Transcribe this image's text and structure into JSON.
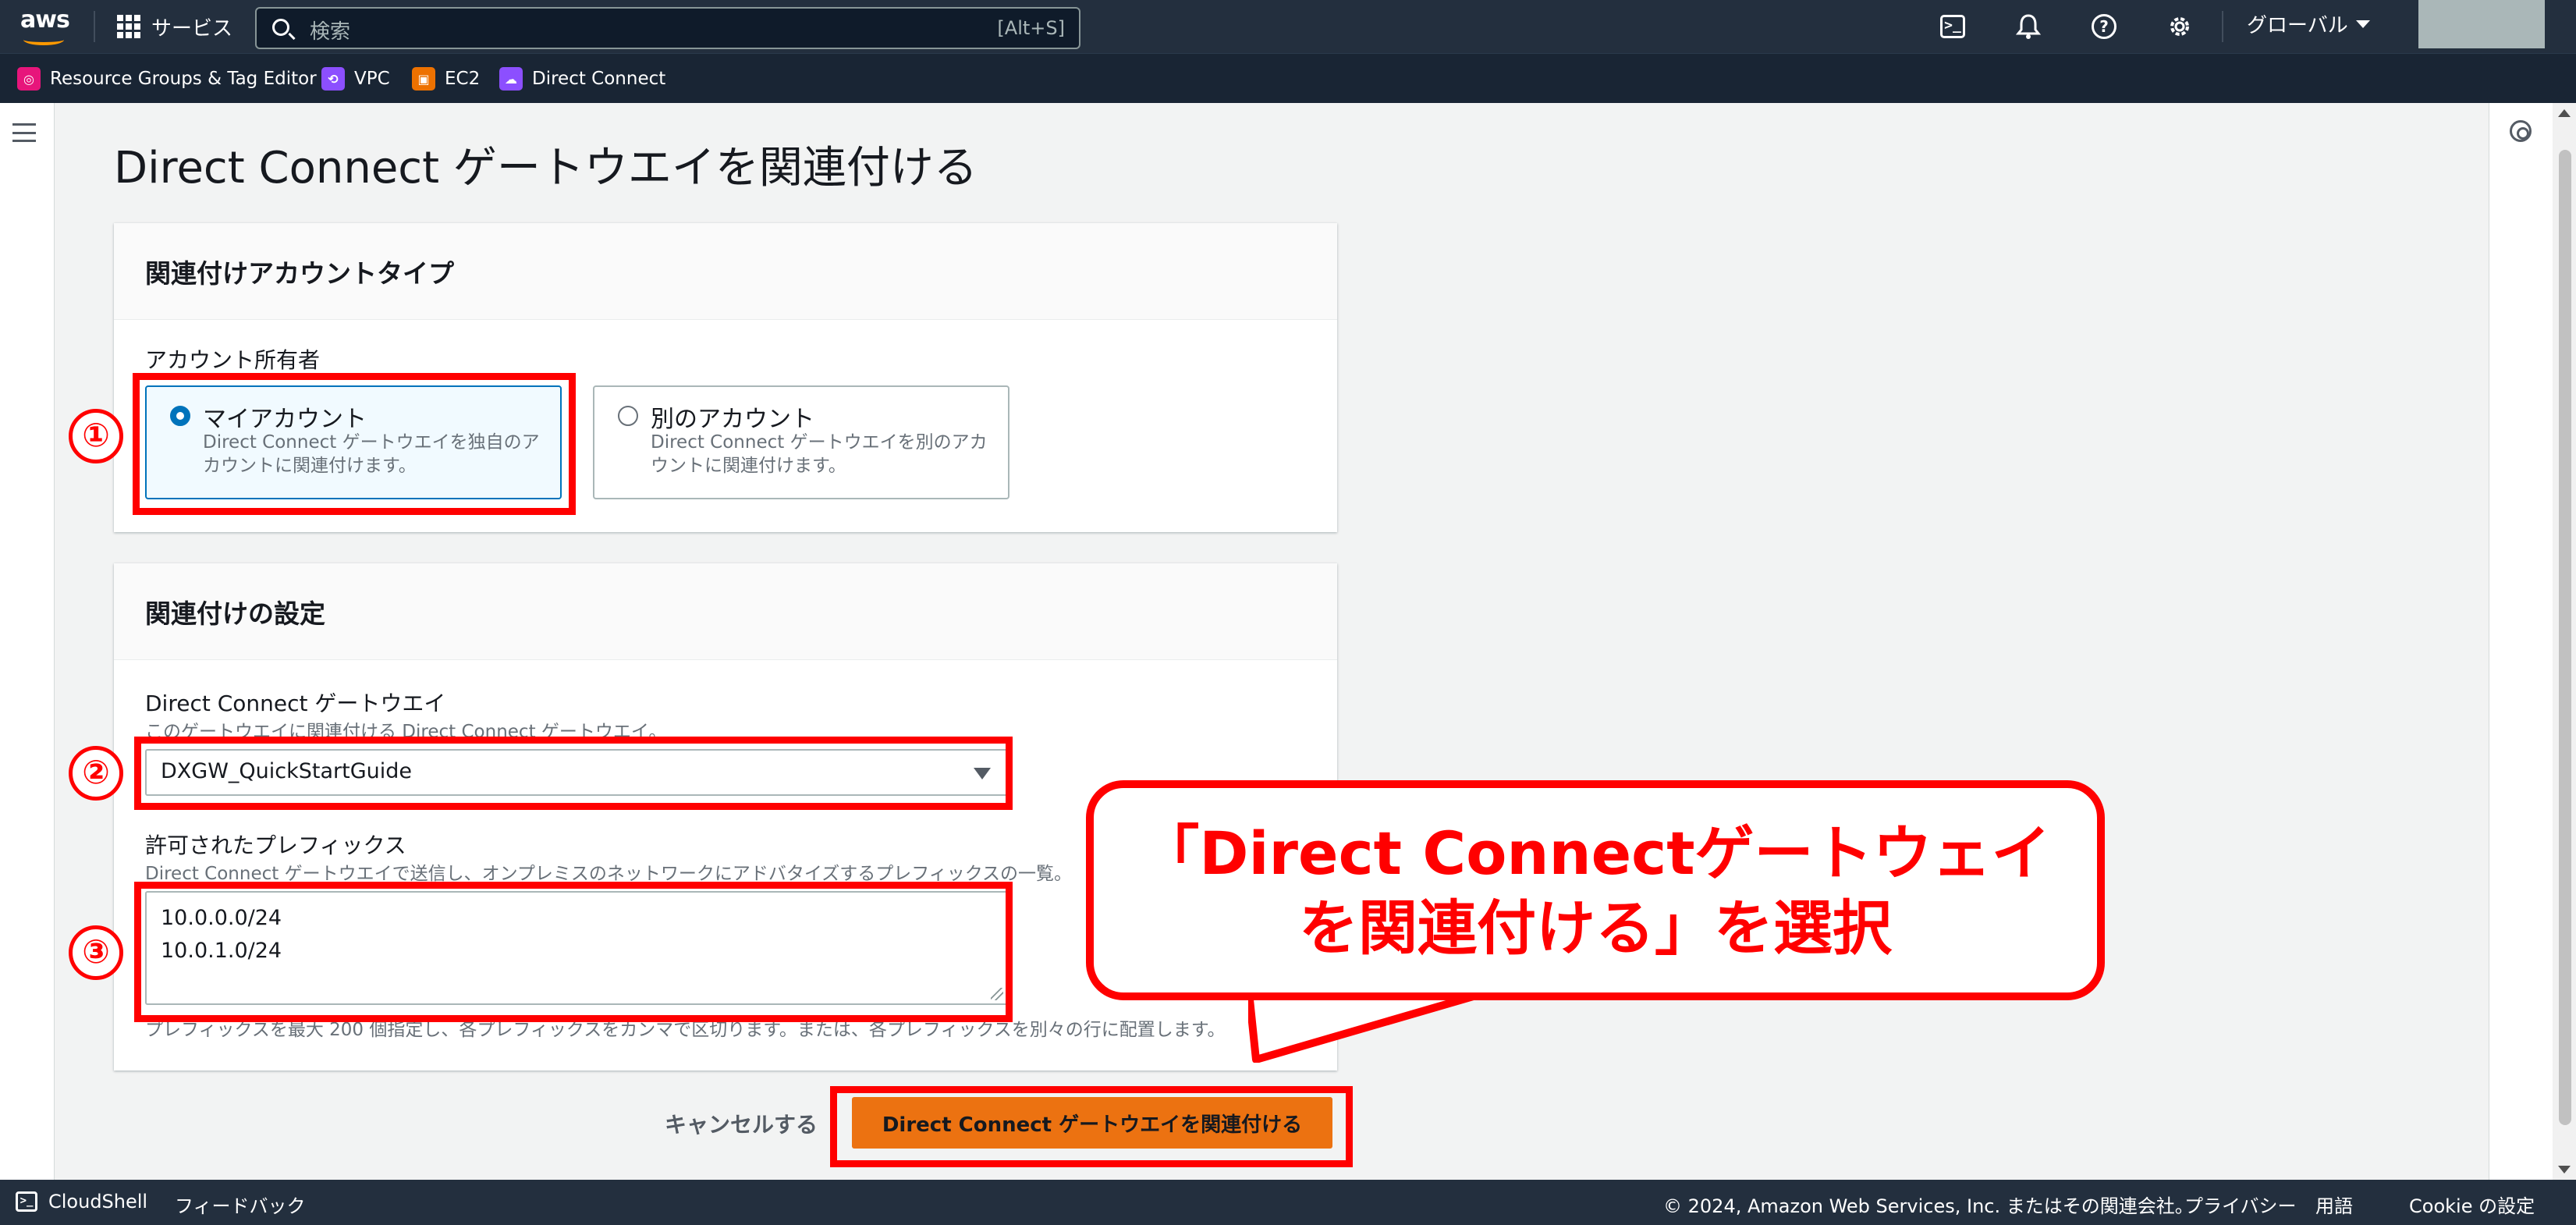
{
  "topnav": {
    "logo_text": "aws",
    "services_label": "サービス",
    "search_placeholder": "検索",
    "search_shortcut": "[Alt+S]",
    "region_label": "グローバル",
    "icons": [
      "terminal-icon",
      "bell-icon",
      "help-icon",
      "gear-icon"
    ]
  },
  "favorites": [
    {
      "label": "Resource Groups & Tag Editor",
      "color": "#e7157b"
    },
    {
      "label": "VPC",
      "color": "#8c4fff"
    },
    {
      "label": "EC2",
      "color": "#ed7100"
    },
    {
      "label": "Direct Connect",
      "color": "#8c4fff"
    }
  ],
  "page": {
    "title": "Direct Connect ゲートウエイを関連付ける"
  },
  "account_panel": {
    "header": "関連付けアカウントタイプ",
    "field_label": "アカウント所有者",
    "options": [
      {
        "title": "マイアカウント",
        "desc": "Direct Connect ゲートウエイを独自のアカウントに関連付けます。",
        "selected": true
      },
      {
        "title": "別のアカウント",
        "desc": "Direct Connect ゲートウエイを別のアカウントに関連付けます。",
        "selected": false
      }
    ]
  },
  "settings_panel": {
    "header": "関連付けの設定",
    "gateway_label": "Direct Connect ゲートウエイ",
    "gateway_desc": "このゲートウエイに関連付ける Direct Connect ゲートウエイ。",
    "gateway_value": "DXGW_QuickStartGuide",
    "prefix_label": "許可されたプレフィックス",
    "prefix_desc": "Direct Connect ゲートウエイで送信し、オンプレミスのネットワークにアドバタイズするプレフィックスの一覧。",
    "prefixes": [
      "10.0.0.0/24",
      "10.0.1.0/24"
    ],
    "prefix_hint": "プレフィックスを最大 200 個指定し、各プレフィックスをカンマで区切ります。または、各プレフィックスを別々の行に配置します。"
  },
  "actions": {
    "cancel_label": "キャンセルする",
    "submit_label": "Direct Connect ゲートウエイを関連付ける"
  },
  "annotations": {
    "steps": [
      "①",
      "②",
      "③"
    ],
    "callout_line1": "「Direct Connectゲートウェイ",
    "callout_line2": "を関連付ける」を選択",
    "color": "#ff0000"
  },
  "footer": {
    "cloudshell": "CloudShell",
    "feedback": "フィードバック",
    "copyright": "© 2024, Amazon Web Services, Inc. またはその関連会社。",
    "privacy": "プライバシー",
    "terms": "用語",
    "cookie": "Cookie の設定"
  },
  "colors": {
    "nav_bg": "#232f3e",
    "primary_button": "#ec7211",
    "selected_blue": "#0073bb"
  }
}
